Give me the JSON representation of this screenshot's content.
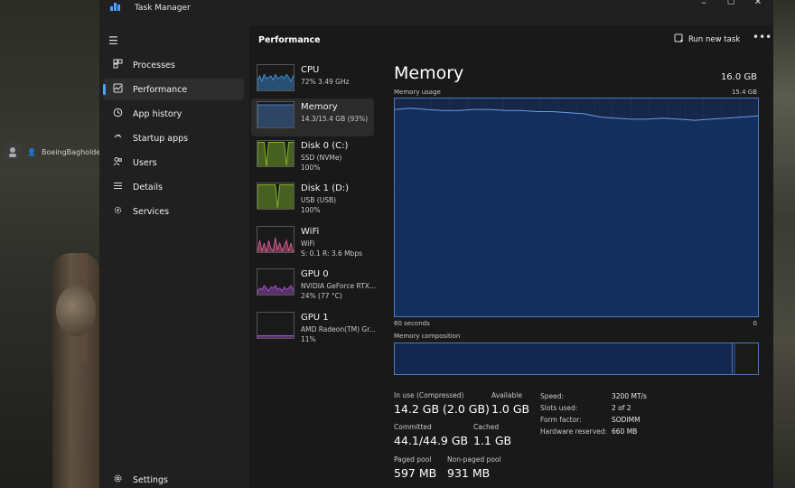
{
  "desktop": {
    "user_name": "BoeingBagholder"
  },
  "window": {
    "title": "Task Manager",
    "controls": {
      "minimize": "–",
      "maximize": "▢",
      "close": "✕"
    }
  },
  "nav": {
    "items": [
      {
        "label": "Processes",
        "icon": "processes-icon"
      },
      {
        "label": "Performance",
        "icon": "performance-icon",
        "active": true
      },
      {
        "label": "App history",
        "icon": "app-history-icon"
      },
      {
        "label": "Startup apps",
        "icon": "startup-apps-icon"
      },
      {
        "label": "Users",
        "icon": "users-icon"
      },
      {
        "label": "Details",
        "icon": "details-icon"
      },
      {
        "label": "Services",
        "icon": "services-icon"
      }
    ],
    "settings_label": "Settings"
  },
  "header": {
    "title": "Performance",
    "run_new_task": "Run new task",
    "more": "•••"
  },
  "devices": [
    {
      "name": "CPU",
      "sub1": "72%  3.49 GHz",
      "sub2": "",
      "color": "#3b8fd6"
    },
    {
      "name": "Memory",
      "sub1": "14.3/15.4 GB (93%)",
      "sub2": "",
      "color": "#4a7ac0",
      "active": true
    },
    {
      "name": "Disk 0 (C:)",
      "sub1": "SSD (NVMe)",
      "sub2": "100%",
      "color": "#7fb62a"
    },
    {
      "name": "Disk 1 (D:)",
      "sub1": "USB (USB)",
      "sub2": "100%",
      "color": "#7fb62a"
    },
    {
      "name": "WiFi",
      "sub1": "WiFi",
      "sub2": "S: 0.1  R: 3.6 Mbps",
      "color": "#d05a8a"
    },
    {
      "name": "GPU 0",
      "sub1": "NVIDIA GeForce RTX...",
      "sub2": "24%  (77 °C)",
      "color": "#a04fc8"
    },
    {
      "name": "GPU 1",
      "sub1": "AMD Radeon(TM) Gr...",
      "sub2": "11%",
      "color": "#a04fc8"
    }
  ],
  "memory": {
    "title": "Memory",
    "total": "16.0 GB",
    "usage_label": "Memory usage",
    "usage_max": "15.4 GB",
    "time_label": "60 seconds",
    "time_end": "0",
    "composition_label": "Memory composition",
    "composition": {
      "in_use_fraction": 0.93,
      "modified_fraction": 0.005
    },
    "usage_history": [
      0.95,
      0.955,
      0.95,
      0.945,
      0.945,
      0.95,
      0.95,
      0.945,
      0.945,
      0.94,
      0.94,
      0.935,
      0.93,
      0.915,
      0.91,
      0.905,
      0.905,
      0.91,
      0.905,
      0.9,
      0.905,
      0.91,
      0.915,
      0.92
    ],
    "stats": {
      "in_use_label": "In use (Compressed)",
      "in_use_value": "14.2 GB (2.0 GB)",
      "available_label": "Available",
      "available_value": "1.0 GB",
      "committed_label": "Committed",
      "committed_value": "44.1/44.9 GB",
      "cached_label": "Cached",
      "cached_value": "1.1 GB",
      "paged_label": "Paged pool",
      "paged_value": "597 MB",
      "nonpaged_label": "Non-paged pool",
      "nonpaged_value": "931 MB"
    },
    "specs": [
      {
        "key": "Speed:",
        "value": "3200 MT/s"
      },
      {
        "key": "Slots used:",
        "value": "2 of 2"
      },
      {
        "key": "Form factor:",
        "value": "SODIMM"
      },
      {
        "key": "Hardware reserved:",
        "value": "660 MB"
      }
    ]
  }
}
